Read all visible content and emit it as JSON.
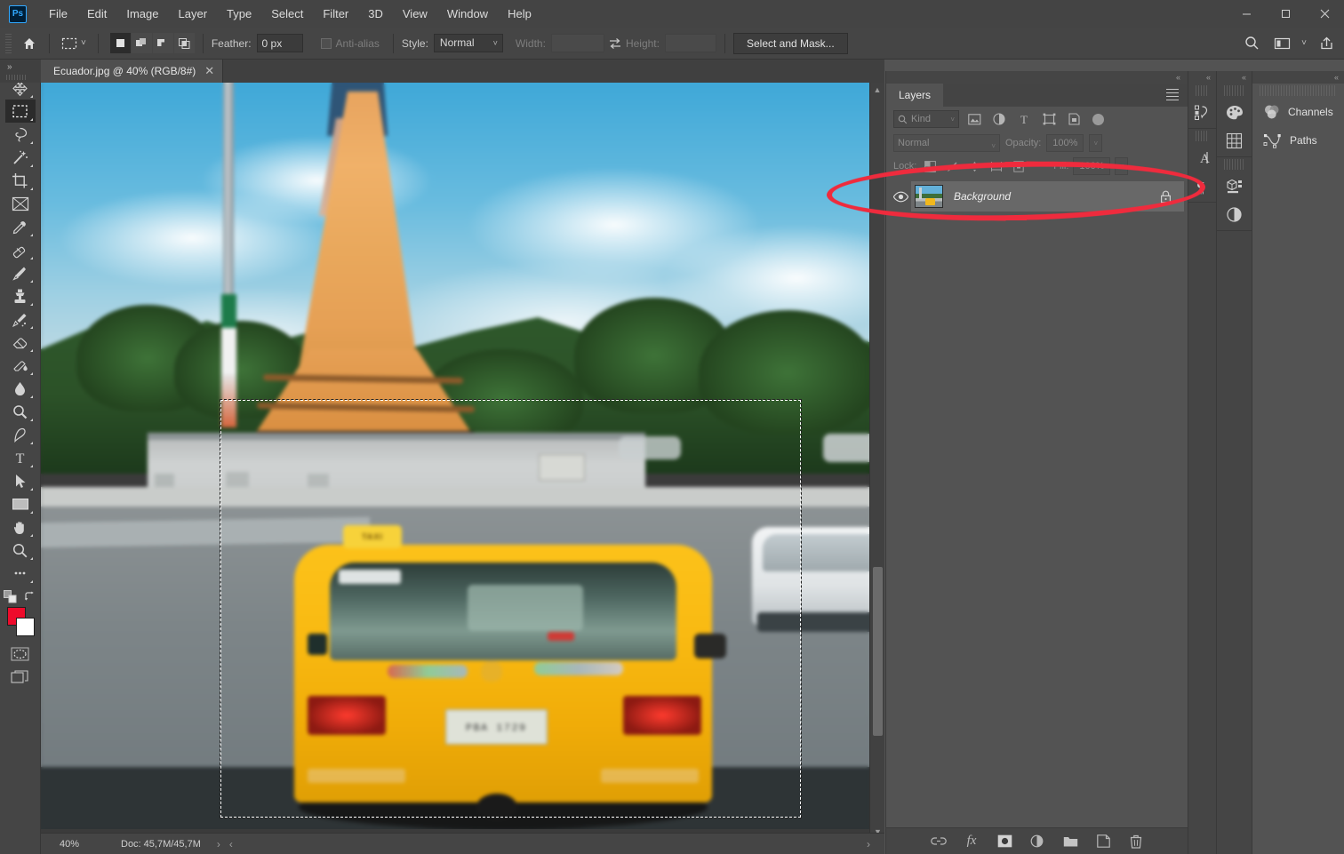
{
  "app": {
    "name": "Photoshop",
    "logo_text": "Ps"
  },
  "menubar": {
    "items": [
      "File",
      "Edit",
      "Image",
      "Layer",
      "Type",
      "Select",
      "Filter",
      "3D",
      "View",
      "Window",
      "Help"
    ]
  },
  "window_controls": {
    "minimize": "–",
    "maximize": "☐",
    "close": "✕"
  },
  "options_bar": {
    "home_icon": "home-icon",
    "tool_icon": "rectangular-marquee-icon",
    "tool_chevron": "˅",
    "selection_modes": [
      "new-selection",
      "add-to-selection",
      "subtract-from-selection",
      "intersect-with-selection"
    ],
    "feather_label": "Feather:",
    "feather_value": "0 px",
    "antialias_label": "Anti-alias",
    "style_label": "Style:",
    "style_value": "Normal",
    "style_chevron": "˅",
    "width_label": "Width:",
    "width_value": "",
    "swap_icon": "swap-dimensions-icon",
    "height_label": "Height:",
    "height_value": "",
    "select_and_mask_label": "Select and Mask...",
    "right_icons": [
      "search-icon",
      "workspace-icon",
      "chevron-down-icon",
      "share-icon"
    ]
  },
  "toolbar": {
    "tools": [
      {
        "name": "move-tool",
        "active": false
      },
      {
        "name": "rectangular-marquee-tool",
        "active": true
      },
      {
        "name": "lasso-tool",
        "active": false
      },
      {
        "name": "magic-wand-tool",
        "active": false
      },
      {
        "name": "crop-tool",
        "active": false
      },
      {
        "name": "frame-tool",
        "active": false
      },
      {
        "name": "eyedropper-tool",
        "active": false
      },
      {
        "name": "spot-healing-brush-tool",
        "active": false
      },
      {
        "name": "brush-tool",
        "active": false
      },
      {
        "name": "clone-stamp-tool",
        "active": false
      },
      {
        "name": "history-brush-tool",
        "active": false
      },
      {
        "name": "eraser-tool",
        "active": false
      },
      {
        "name": "gradient-tool",
        "active": false
      },
      {
        "name": "blur-tool",
        "active": false
      },
      {
        "name": "dodge-tool",
        "active": false
      },
      {
        "name": "pen-tool",
        "active": false
      },
      {
        "name": "type-tool",
        "active": false
      },
      {
        "name": "path-selection-tool",
        "active": false
      },
      {
        "name": "rectangle-tool",
        "active": false
      },
      {
        "name": "hand-tool",
        "active": false
      },
      {
        "name": "zoom-tool",
        "active": false
      },
      {
        "name": "edit-toolbar-tool",
        "active": false
      }
    ],
    "foreground_color": "#ee0b2b",
    "background_color": "#ffffff",
    "quick_mask_name": "quick-mask-mode",
    "screen_mode_name": "change-screen-mode"
  },
  "document": {
    "tab_title": "Ecuador.jpg @ 40% (RGB/8#)",
    "close_glyph": "✕"
  },
  "status_bar": {
    "zoom": "40%",
    "doc_info": "Doc: 45,7M/45,7M",
    "next_glyph": "›",
    "prev_glyph": "‹"
  },
  "layers_panel": {
    "tab_label": "Layers",
    "collapse_glyph": "«",
    "filter": {
      "kind_label": "Kind",
      "search_icon": "search-icon",
      "chevron": "˅",
      "icons": [
        "pixel-layers-filter-icon",
        "adjustment-layers-filter-icon",
        "type-layers-filter-icon",
        "shape-layers-filter-icon",
        "smart-object-filter-icon"
      ],
      "toggle_name": "filter-toggle-switch"
    },
    "blend_mode": "Normal",
    "blend_chevron": "˅",
    "opacity_label": "Opacity:",
    "opacity_value": "100%",
    "lock_label": "Lock:",
    "lock_icons": [
      "lock-transparent-pixels-icon",
      "lock-image-pixels-icon",
      "lock-position-icon",
      "lock-artboard-nesting-icon",
      "lock-all-icon"
    ],
    "fill_label": "Fill:",
    "fill_value": "100%",
    "layers": [
      {
        "name": "Background",
        "visible": true,
        "locked": true,
        "eye_icon": "eye-icon",
        "lock_icon": "lock-icon"
      }
    ],
    "footer_icons": [
      "link-layers-icon",
      "add-layer-style-icon",
      "add-layer-mask-icon",
      "new-adjustment-layer-icon",
      "new-group-icon",
      "new-layer-icon",
      "delete-layer-icon"
    ],
    "footer_fx_label": "fx"
  },
  "icon_docks": {
    "collapse_glyph": "«",
    "column_a": [
      "history-icon",
      "character-icon",
      "paragraph-icon"
    ],
    "column_b": [
      "color-icon",
      "swatches-icon",
      "3d-icon",
      "adjustments-icon"
    ],
    "column_c_tabs": [
      {
        "label": "Channels",
        "icon": "channels-icon"
      },
      {
        "label": "Paths",
        "icon": "paths-icon"
      }
    ]
  },
  "annotation": {
    "shape": "red-ellipse-highlight",
    "color": "#ef2b3d",
    "target": "Background layer row"
  },
  "canvas": {
    "selection_name": "marching-ants-selection",
    "image_description": "Ecuador street photo with yellow taxi",
    "license_plate": "PBA 1729",
    "taxi_sign": "TAXI"
  },
  "colors": {
    "chrome_dark": "#444444",
    "panel_bg": "#535353",
    "accent_blue": "#31a8ff",
    "annotation_red": "#ef2b3d",
    "taxi_yellow": "#fcc21a"
  }
}
